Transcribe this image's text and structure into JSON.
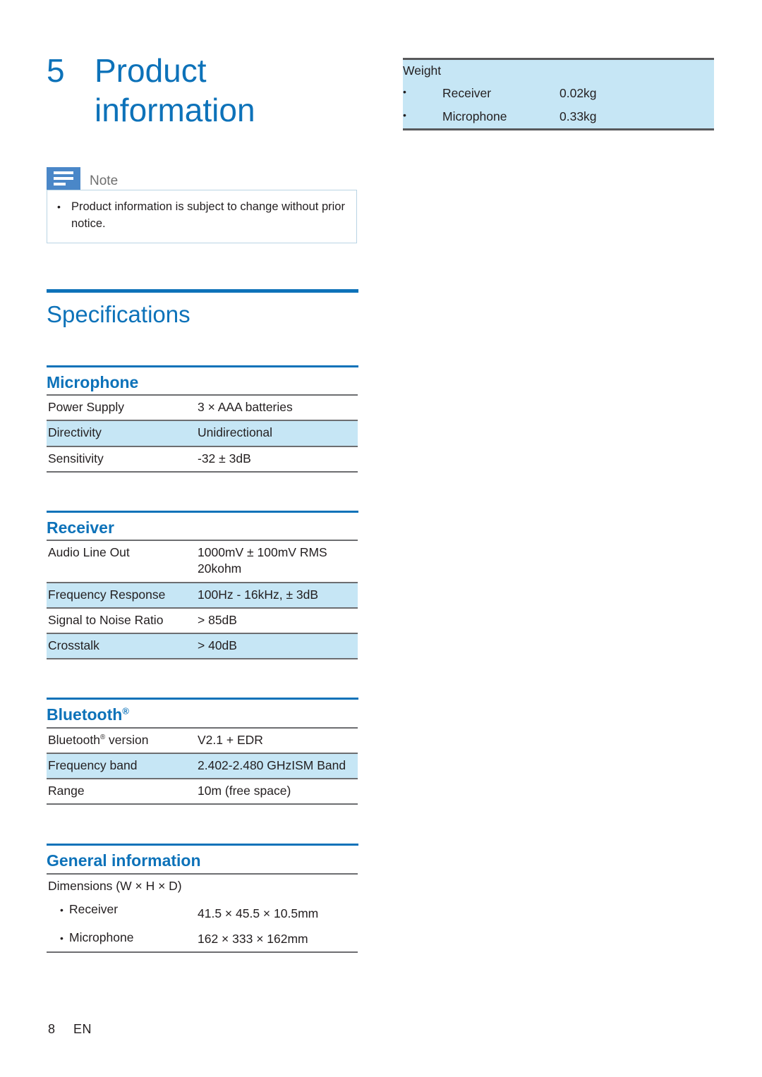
{
  "chapter": {
    "number": "5",
    "title_line1": "Product",
    "title_line2": "information"
  },
  "note": {
    "label": "Note",
    "bullet": "•",
    "text": "Product information is subject to change without prior notice."
  },
  "specifications": {
    "heading": "Specifications",
    "sections": [
      {
        "heading": "Microphone",
        "heading_suffix": "",
        "rows": [
          {
            "key": "Power Supply",
            "value": "3 × AAA batteries",
            "shaded": false
          },
          {
            "key": "Directivity",
            "value": "Unidirectional",
            "shaded": true
          },
          {
            "key": "Sensitivity",
            "value": "-32 ± 3dB",
            "shaded": false
          }
        ]
      },
      {
        "heading": "Receiver",
        "heading_suffix": "",
        "rows": [
          {
            "key": "Audio Line Out",
            "value": "1000mV ± 100mV RMS 20kohm",
            "shaded": false
          },
          {
            "key": "Frequency Response",
            "value": "100Hz - 16kHz, ± 3dB",
            "shaded": true
          },
          {
            "key": "Signal to Noise Ratio",
            "value": "> 85dB",
            "shaded": false
          },
          {
            "key": "Crosstalk",
            "value": "> 40dB",
            "shaded": true
          }
        ]
      },
      {
        "heading": "Bluetooth",
        "heading_suffix": "®",
        "rows": [
          {
            "key": "Bluetooth® version",
            "value": "V2.1 + EDR",
            "shaded": false
          },
          {
            "key": "Frequency band",
            "value": "2.402-2.480 GHzISM Band",
            "shaded": true
          },
          {
            "key": "Range",
            "value": "10m (free space)",
            "shaded": false
          }
        ]
      }
    ],
    "general": {
      "heading": "General information",
      "dimensions_label": "Dimensions (W × H × D)",
      "bullet": "•",
      "items": [
        {
          "label": "Receiver",
          "value": "41.5 × 45.5 × 10.5mm"
        },
        {
          "label": "Microphone",
          "value": "162 × 333 × 162mm"
        }
      ]
    }
  },
  "weight_table": {
    "title": "Weight",
    "bullet": "•",
    "items": [
      {
        "label": "Receiver",
        "value": "0.02kg"
      },
      {
        "label": "Microphone",
        "value": "0.33kg"
      }
    ]
  },
  "footer": {
    "page_number": "8",
    "language": "EN"
  },
  "colors": {
    "brand_blue": "#0d72b9",
    "row_shade": "#c6e6f5",
    "note_icon": "#4a87c8",
    "rule_dark": "#6d6e71"
  }
}
